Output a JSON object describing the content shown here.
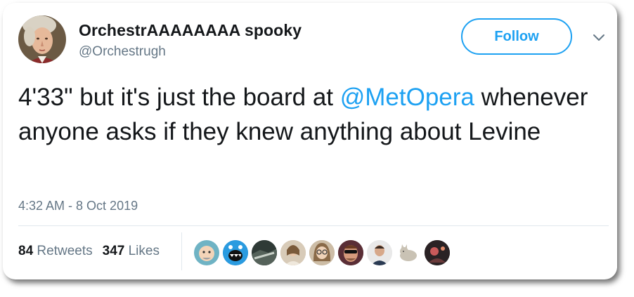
{
  "user": {
    "name": "OrchestrAAAAAAAA spooky",
    "handle": "@Orchestrugh"
  },
  "follow_label": "Follow",
  "tweet": {
    "text_before": "4'33\" but it's just the board at ",
    "mention": "@MetOpera",
    "text_after": " whenever anyone asks if they knew anything about Levine"
  },
  "timestamp": "4:32 AM - 8 Oct 2019",
  "stats": {
    "retweets_count": "84",
    "retweets_label": "Retweets",
    "likes_count": "347",
    "likes_label": "Likes"
  },
  "colors": {
    "accent": "#1da1f2",
    "text": "#14171a",
    "muted": "#657786",
    "border": "#e1e8ed"
  },
  "likers": [
    {
      "icon": "cartoon-bald-face-avatar",
      "bg": "#6fb3c4"
    },
    {
      "icon": "blue-monster-avatar",
      "bg": "#1f7fc2"
    },
    {
      "icon": "dark-landscape-avatar",
      "bg": "#3c4a44"
    },
    {
      "icon": "woman-photo-avatar",
      "bg": "#c9b9a6"
    },
    {
      "icon": "woman-glasses-avatar",
      "bg": "#b8a48c"
    },
    {
      "icon": "man-sunglasses-avatar",
      "bg": "#6a3a3a"
    },
    {
      "icon": "man-portrait-avatar",
      "bg": "#e8e8e8"
    },
    {
      "icon": "cat-drawing-avatar",
      "bg": "#ffffff"
    },
    {
      "icon": "person-red-light-avatar",
      "bg": "#3a2a2a"
    }
  ]
}
